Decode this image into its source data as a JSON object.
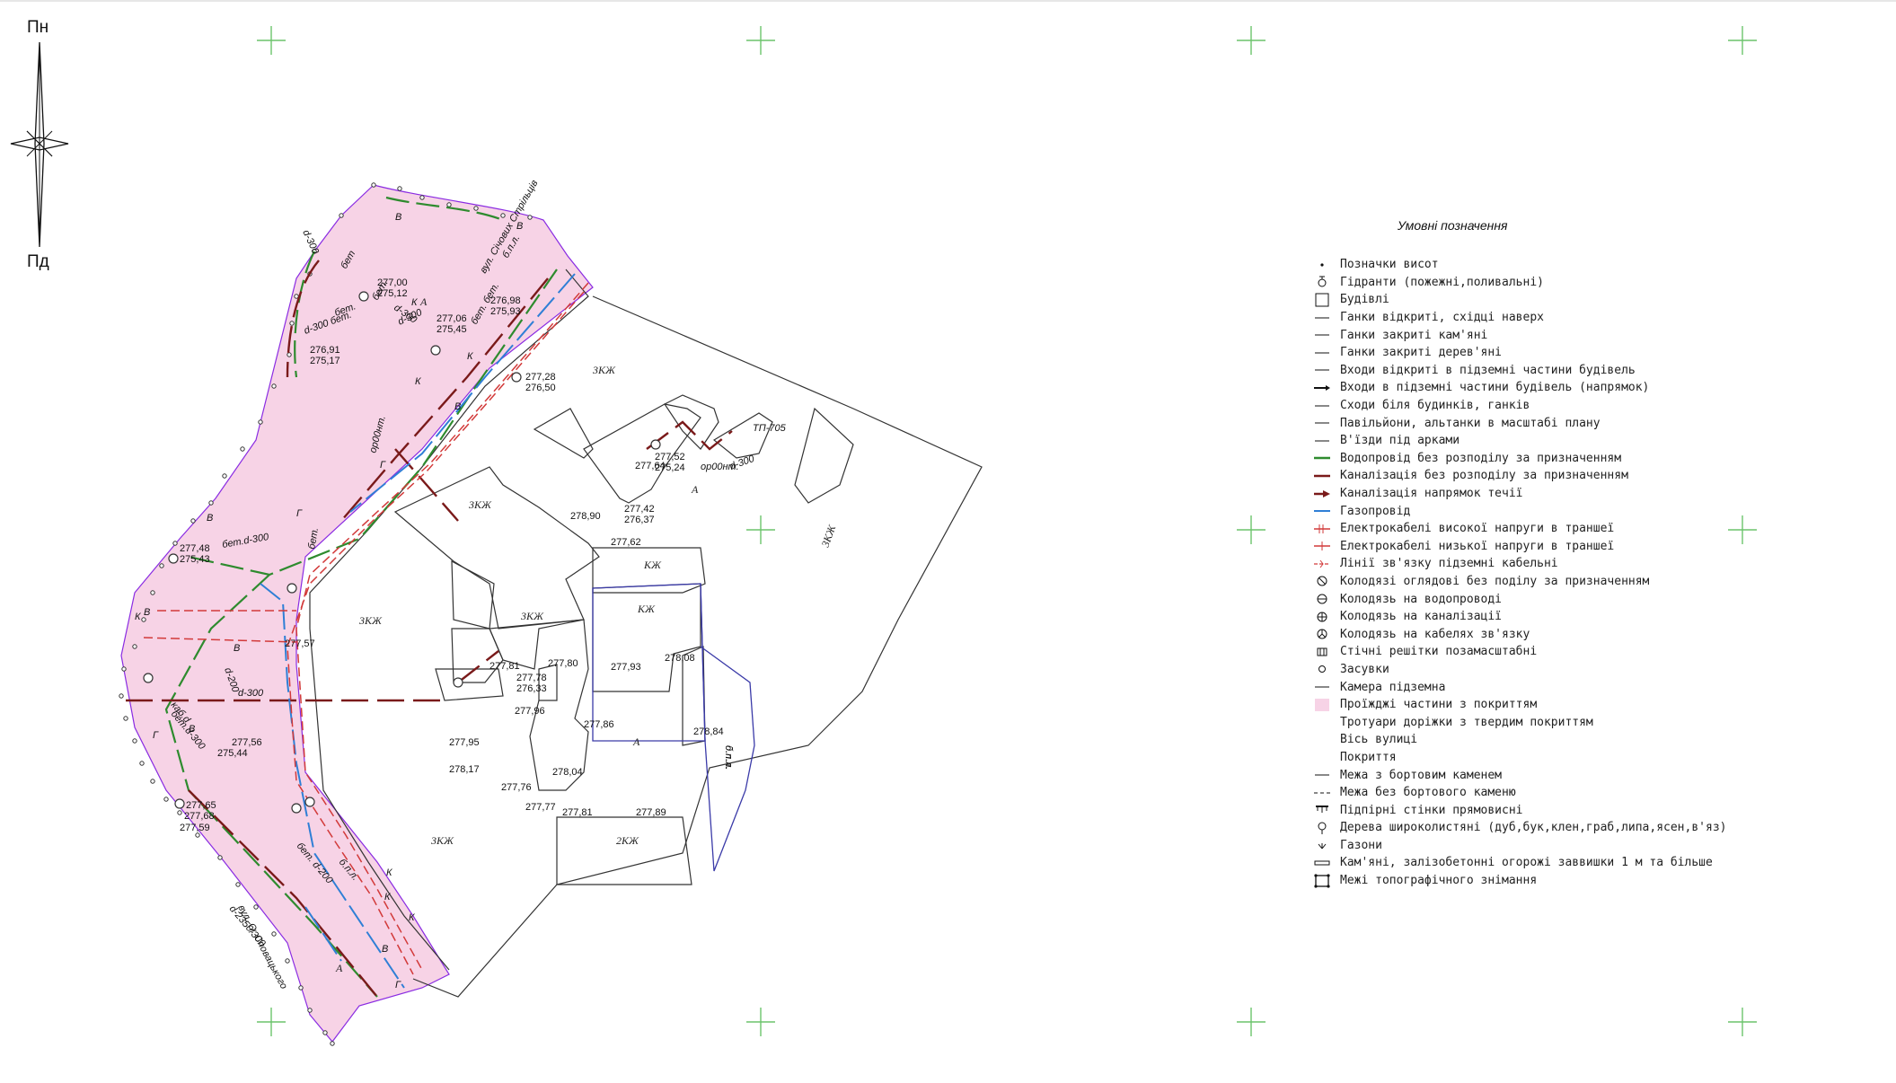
{
  "compass": {
    "north": "Пн",
    "south": "Пд"
  },
  "streets": [
    {
      "name": "вул. Січових Стрільців"
    },
    {
      "name": "вул. О. Сповацького"
    }
  ],
  "zones": [
    "3КЖ",
    "3КЖ",
    "3КЖ",
    "3КЖ",
    "3КЖ",
    "3КЖ",
    "КЖ",
    "КЖ",
    "2КЖ",
    "А",
    "А",
    "А",
    "А",
    "б.п.л."
  ],
  "elevation_labels": [
    "277,00",
    "275,12",
    "276,98",
    "275,93",
    "277,06",
    "275,45",
    "276,91",
    "275,17",
    "277,28",
    "276,50",
    "277,48",
    "275,43",
    "277,78",
    "276,33",
    "277,42",
    "276,37",
    "277,52",
    "275,24",
    "277,62",
    "278,90",
    "277,64",
    "277,81",
    "277,80",
    "277,93",
    "278,08",
    "277,96",
    "277,86",
    "277,95",
    "278,17",
    "277,76",
    "278,04",
    "277,77",
    "277,81",
    "277,89",
    "278,84",
    "277,56",
    "275,44",
    "277,65",
    "277,68",
    "277,59",
    "277,57"
  ],
  "pipe_labels": [
    "d-300",
    "бет",
    "d-300",
    "бет.",
    "бет. бет.",
    "б.п.л.",
    "d-300 бет.",
    "бет.",
    "d-300",
    "ор00нт.",
    "бет.d-300",
    "бет.",
    "ор00нт.",
    "d-300",
    "d-200",
    "d-300",
    "каб.d",
    "бет.d-300",
    "d-2350/300",
    "бет. d-200",
    "б.п.л.",
    "д.п.л.",
    "ТП-705"
  ],
  "pipe_letters": [
    "В",
    "В",
    "К",
    "В",
    "К",
    "Г",
    "В",
    "К",
    "В",
    "В",
    "К",
    "В",
    "Г",
    "К",
    "К",
    "Г",
    "В",
    "Г",
    "К"
  ],
  "legend": {
    "title": "Умовні позначення",
    "items": [
      {
        "icon": "dot-icon",
        "label": "Позначки висот"
      },
      {
        "icon": "hydrant-icon",
        "label": "Гідранти (пожежні,поливальні)"
      },
      {
        "icon": "square-icon",
        "label": "Будівлі"
      },
      {
        "icon": "thin-line-icon",
        "label": "Ганки відкриті, східці наверх"
      },
      {
        "icon": "thin-line-icon",
        "label": "Ганки закриті кам'яні"
      },
      {
        "icon": "thin-line-icon",
        "label": "Ганки закриті дерев'яні"
      },
      {
        "icon": "thin-line-icon",
        "label": "Входи відкриті в підземні частини будівель"
      },
      {
        "icon": "arrow-line-icon",
        "label": "Входи в підземні частини будівель (напрямок)"
      },
      {
        "icon": "thin-line-icon",
        "label": "Сходи біля будинків, ганків"
      },
      {
        "icon": "thin-line-icon",
        "label": "Павільйони, альтанки в масштабі плану"
      },
      {
        "icon": "thin-line-icon",
        "label": "В'їзди під арками"
      },
      {
        "icon": "green-line-icon",
        "label": "Водопровід без розподілу за призначенням"
      },
      {
        "icon": "darkred-line-icon",
        "label": "Каналізація без розподілу за призначенням"
      },
      {
        "icon": "darkred-arrow-icon",
        "label": "Каналізація напрямок течії"
      },
      {
        "icon": "blue-line-icon",
        "label": "Газопровід"
      },
      {
        "icon": "red-hv-line-icon",
        "label": "Електрокабелі високої напруги в траншеї"
      },
      {
        "icon": "red-lv-line-icon",
        "label": "Електрокабелі низької напруги в траншеї"
      },
      {
        "icon": "red-comm-line-icon",
        "label": "Лінії зв'язку підземні кабельні"
      },
      {
        "icon": "well-generic-icon",
        "label": "Колодязі оглядові без поділу за призначенням"
      },
      {
        "icon": "well-water-icon",
        "label": "Колодязь на водопроводі"
      },
      {
        "icon": "well-sewer-icon",
        "label": "Колодязь на каналізації"
      },
      {
        "icon": "well-cable-icon",
        "label": "Колодязь на кабелях зв'язку"
      },
      {
        "icon": "grate-icon",
        "label": "Стічні решітки позамасштабні"
      },
      {
        "icon": "valve-icon",
        "label": "Засувки"
      },
      {
        "icon": "thin-line-icon",
        "label": "Камера підземна"
      },
      {
        "icon": "pink-fill-icon",
        "label": "Проїжджі частини з покриттям"
      },
      {
        "icon": "none",
        "label": "Тротуари доріжки з твердим покриттям"
      },
      {
        "icon": "none",
        "label": "Вісь вулиці"
      },
      {
        "icon": "none",
        "label": "Покриття"
      },
      {
        "icon": "thin-line-icon",
        "label": "Межа з бортовим каменем"
      },
      {
        "icon": "dashed-line-icon",
        "label": "Межа без бортового каменю"
      },
      {
        "icon": "retaining-wall-icon",
        "label": "Підпірні стінки прямовисні"
      },
      {
        "icon": "tree-icon",
        "label": "Дерева широколистяні (дуб,бук,клен,граб,липа,ясен,в'яз)"
      },
      {
        "icon": "lawn-icon",
        "label": "Газони"
      },
      {
        "icon": "fence-icon",
        "label": "Кам'яні, залізобетонні огорожі заввишки 1 м та більше"
      },
      {
        "icon": "survey-boundary-icon",
        "label": "Межі топографічного знімання"
      }
    ]
  },
  "colors": {
    "road_fill": "#f7d3e6",
    "water": "#2e8b2e",
    "sewer": "#7a1a1a",
    "gas": "#2f7fd6",
    "power": "#d23a3a",
    "building_outline": "#333333",
    "parcel_outline": "#3a3aa8",
    "survey_boundary": "#8a2be2",
    "grid_cross": "#6cc46c"
  }
}
